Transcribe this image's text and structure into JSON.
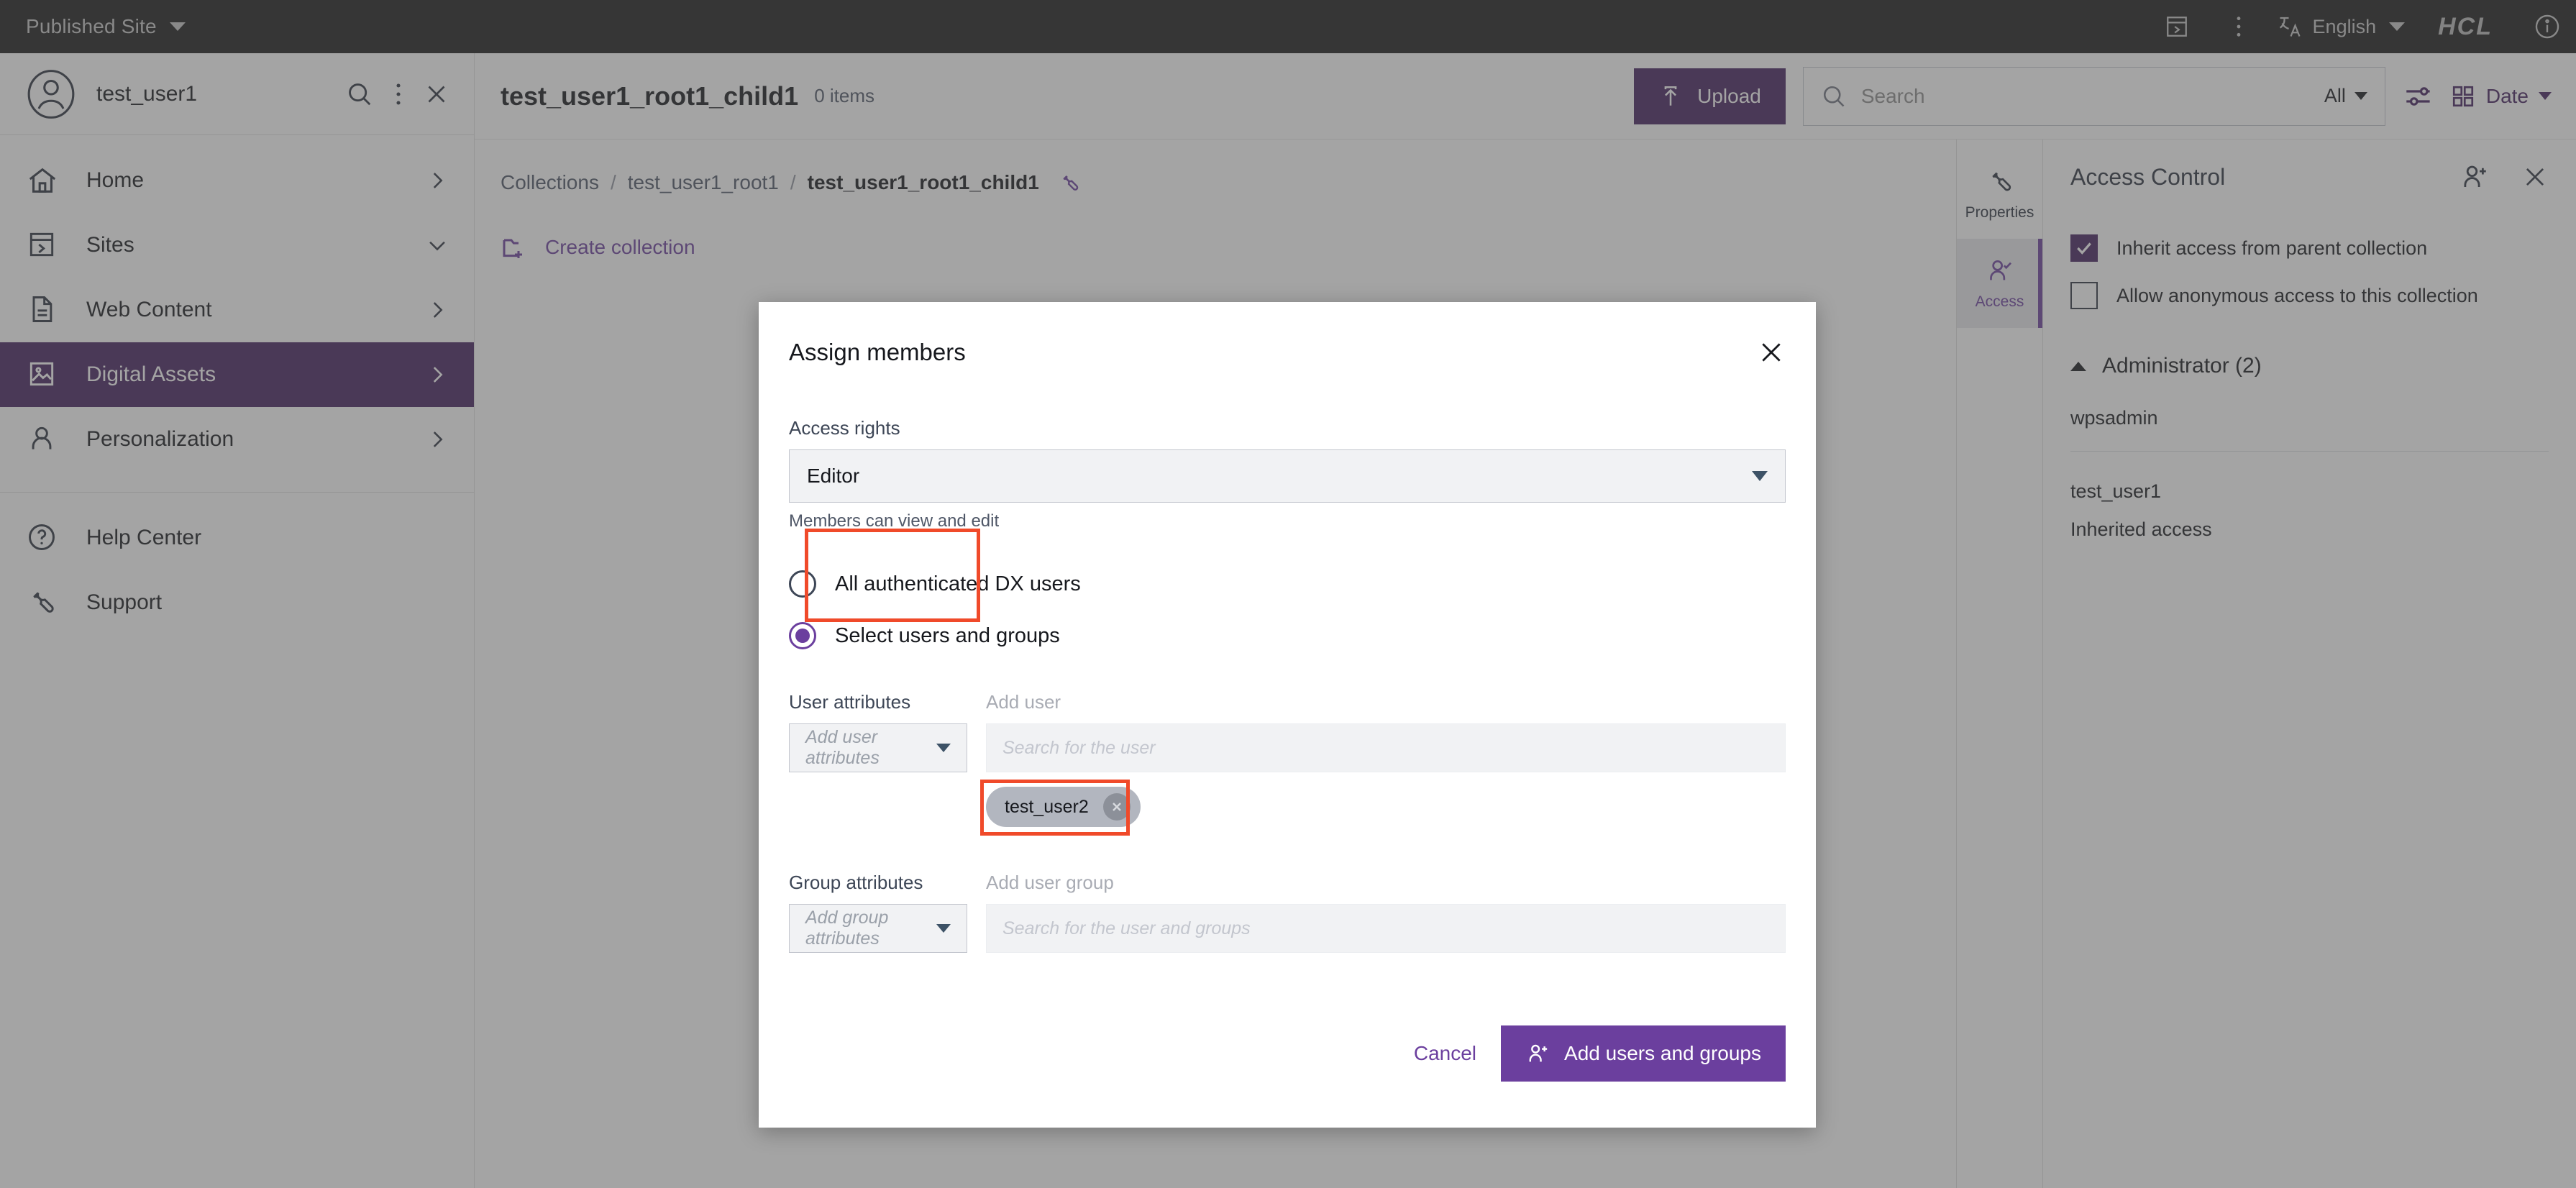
{
  "topbar": {
    "site_label": "Published Site",
    "language": "English",
    "brand": "HCL",
    "icons": [
      "sites-icon",
      "overflow-menu-icon",
      "translate-icon",
      "info-icon"
    ]
  },
  "sidebar": {
    "user": "test_user1",
    "actions": [
      "search-icon",
      "overflow-menu-icon",
      "close-icon"
    ],
    "items": [
      {
        "label": "Home",
        "icon": "home-icon",
        "chevron": "right",
        "active": false
      },
      {
        "label": "Sites",
        "icon": "sites-icon",
        "chevron": "down",
        "active": false
      },
      {
        "label": "Web Content",
        "icon": "document-icon",
        "chevron": "right",
        "active": false
      },
      {
        "label": "Digital Assets",
        "icon": "image-icon",
        "chevron": "right",
        "active": true
      },
      {
        "label": "Personalization",
        "icon": "user-icon",
        "chevron": "right",
        "active": false
      }
    ],
    "footer_items": [
      {
        "label": "Help Center",
        "icon": "help-icon"
      },
      {
        "label": "Support",
        "icon": "wrench-icon"
      }
    ]
  },
  "main": {
    "title": "test_user1_root1_child1",
    "item_count": "0 items",
    "upload_label": "Upload",
    "search_placeholder": "Search",
    "search_value": "",
    "search_filter": "All",
    "sort_label": "Date",
    "breadcrumb": [
      "Collections",
      "test_user1_root1",
      "test_user1_root1_child1"
    ],
    "breadcrumb_separator": "/",
    "create_collection_label": "Create collection"
  },
  "right_panel": {
    "tabs": [
      {
        "label": "Properties",
        "icon": "wrench-icon",
        "active": false
      },
      {
        "label": "Access",
        "icon": "user-check-icon",
        "active": true
      }
    ],
    "title": "Access Control",
    "head_icons": [
      "add-user-icon",
      "close-icon"
    ],
    "checkboxes": [
      {
        "label": "Inherit access from parent collection",
        "checked": true
      },
      {
        "label": "Allow anonymous access to this collection",
        "checked": false
      }
    ],
    "group_title": "Administrator (2)",
    "members": [
      {
        "name": "wpsadmin",
        "sub": ""
      },
      {
        "name": "test_user1",
        "sub": "Inherited access"
      }
    ]
  },
  "modal": {
    "title": "Assign members",
    "access_rights_label": "Access rights",
    "access_rights_value": "Editor",
    "access_rights_helper": "Members can view and edit",
    "radios": [
      {
        "label": "All authenticated DX users",
        "selected": false
      },
      {
        "label": "Select users and groups",
        "selected": true
      }
    ],
    "user_attributes_label": "User attributes",
    "user_attributes_placeholder": "Add user attributes",
    "add_user_label": "Add user",
    "add_user_placeholder": "Search for the user",
    "chips": [
      "test_user2"
    ],
    "group_attributes_label": "Group attributes",
    "group_attributes_placeholder": "Add group attributes",
    "add_user_group_label": "Add user group",
    "add_user_group_placeholder": "Search for the user and groups",
    "cancel_label": "Cancel",
    "submit_label": "Add users and groups"
  },
  "colors": {
    "brand_purple": "#6b3f9e",
    "dark_purple": "#44215e",
    "topbar": "#1b1b1b",
    "annotation_red": "#f04a2a"
  }
}
